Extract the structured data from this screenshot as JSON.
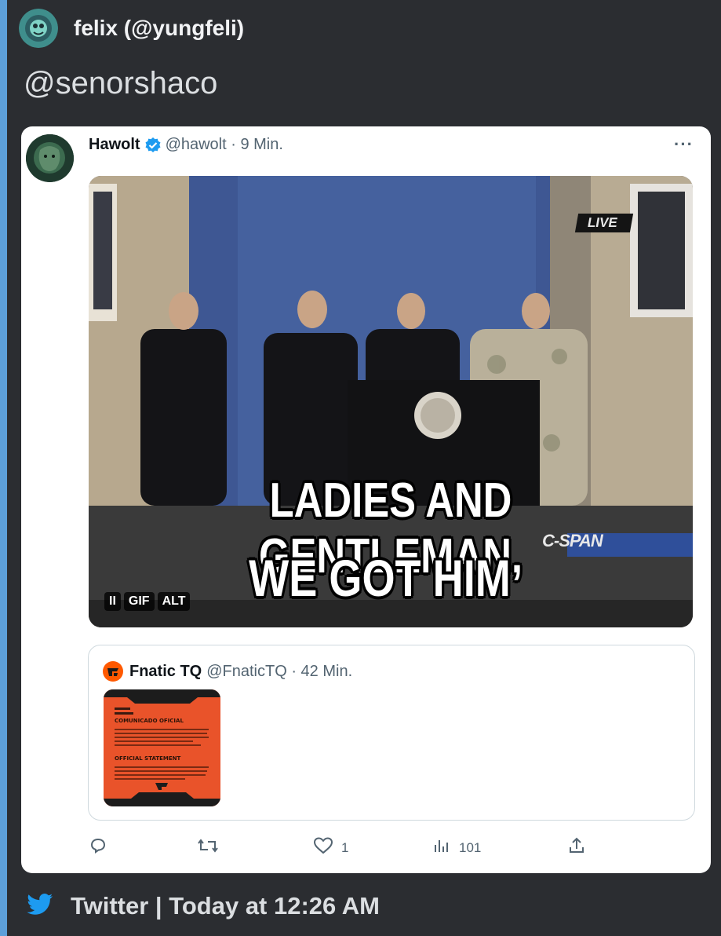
{
  "embed": {
    "author": "felix (@yungfeli)",
    "message": "@senorshaco",
    "footer": "Twitter | Today at 12:26 AM",
    "accent_color": "#5d9fd9"
  },
  "tweet": {
    "name": "Hawolt",
    "handle_time": "@hawolt · 9 Min.",
    "more": "···",
    "media": {
      "live_badge": "LIVE",
      "watermark": "C-SPAN",
      "caption_line1": "LADIES AND GENTLEMAN,",
      "caption_line2": "WE GOT HIM",
      "controls": [
        "II",
        "GIF",
        "ALT"
      ]
    },
    "quoted": {
      "name": "Fnatic TQ",
      "handle_time": "@FnaticTQ · 42 Min.",
      "thumb_color": "#e9532a",
      "thumb_text": [
        "COMUNICADO OFICIAL",
        "OFFICIAL STATEMENT"
      ]
    },
    "actions": {
      "reply_count": "",
      "retweet_count": "",
      "like_count": "1",
      "views_count": "101"
    }
  }
}
